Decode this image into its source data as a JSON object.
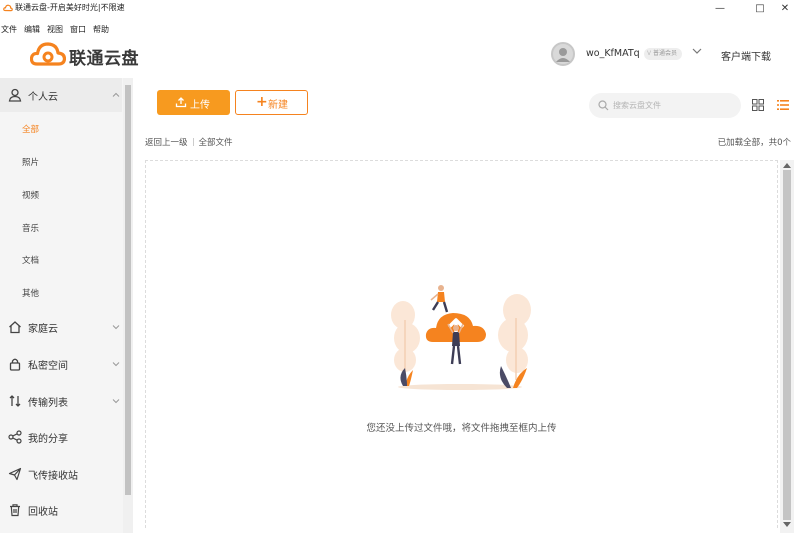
{
  "window": {
    "title": "联通云盘-开启美好时光|不限速",
    "minimize_glyph": "—",
    "maximize_glyph": "□",
    "close_glyph": "✕"
  },
  "menu": [
    "文件",
    "编辑",
    "视图",
    "窗口",
    "帮助"
  ],
  "header": {
    "brand": "联通云盘",
    "username": "wo_KfMATq",
    "member_badge": "普通会员",
    "download_link": "客户端下载"
  },
  "sidebar": {
    "personal_cloud": {
      "label": "个人云",
      "icon": "user-icon",
      "children": [
        {
          "label": "全部",
          "active": true
        },
        {
          "label": "照片",
          "active": false
        },
        {
          "label": "视频",
          "active": false
        },
        {
          "label": "音乐",
          "active": false
        },
        {
          "label": "文档",
          "active": false
        },
        {
          "label": "其他",
          "active": false
        }
      ]
    },
    "items": [
      {
        "label": "家庭云",
        "icon": "home-icon",
        "expandable": true
      },
      {
        "label": "私密空间",
        "icon": "lock-icon",
        "expandable": true
      },
      {
        "label": "传输列表",
        "icon": "transfer-icon",
        "expandable": true
      },
      {
        "label": "我的分享",
        "icon": "share-icon",
        "expandable": false
      },
      {
        "label": "飞传接收站",
        "icon": "paper-plane-icon",
        "expandable": false
      },
      {
        "label": "回收站",
        "icon": "trash-icon",
        "expandable": false
      }
    ]
  },
  "toolbar": {
    "upload_label": "上传",
    "new_label": "新建",
    "search_placeholder": "搜索云盘文件"
  },
  "breadcrumb": {
    "back": "返回上一级",
    "current": "全部文件"
  },
  "status_text": "已加载全部，共0个",
  "empty_message": "您还没上传过文件哦，将文件拖拽至框内上传",
  "colors": {
    "accent": "#f5831f",
    "upload_button": "#f79a1f",
    "sidebar_bg": "#f5f5f5"
  }
}
